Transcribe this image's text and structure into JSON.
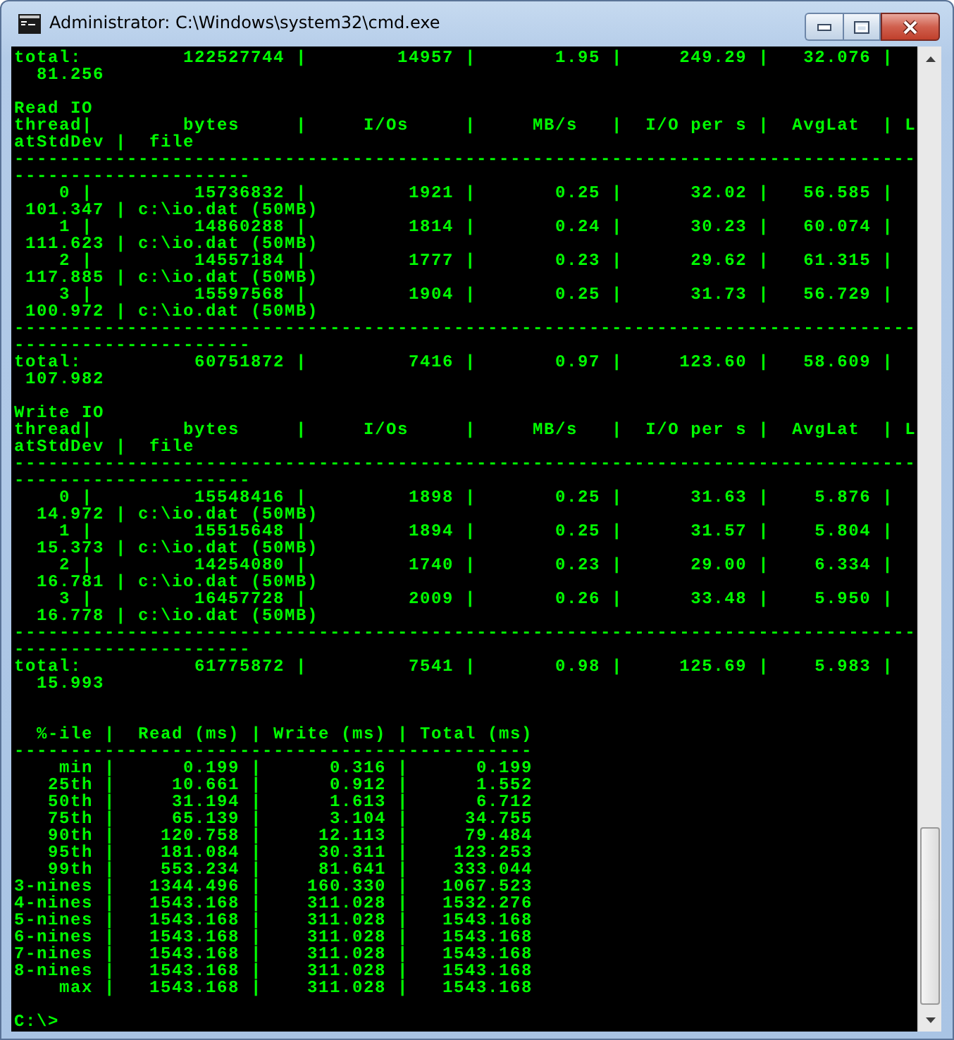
{
  "window": {
    "title": "Administrator: C:\\Windows\\system32\\cmd.exe"
  },
  "console": {
    "lines": [
      {
        "kind": "text",
        "text": "total:         122527744 |        14957 |       1.95 |     249.29 |   32.076 |"
      },
      {
        "kind": "text",
        "text": "  81.256"
      },
      {
        "kind": "blank"
      },
      {
        "kind": "text",
        "text": "Read IO"
      },
      {
        "kind": "text",
        "text": "thread|        bytes     |     I/Os     |     MB/s   |  I/O per s |  AvgLat  | L"
      },
      {
        "kind": "text",
        "text": "atStdDev |  file"
      },
      {
        "kind": "text",
        "text": "--------------------------------------------------------------------------------"
      },
      {
        "kind": "text",
        "text": "---------------------"
      },
      {
        "kind": "text",
        "text": "    0 |         15736832 |         1921 |       0.25 |      32.02 |   56.585 |"
      },
      {
        "kind": "text",
        "text": " 101.347 | c:\\io.dat (50MB)"
      },
      {
        "kind": "text",
        "text": "    1 |         14860288 |         1814 |       0.24 |      30.23 |   60.074 |"
      },
      {
        "kind": "text",
        "text": " 111.623 | c:\\io.dat (50MB)"
      },
      {
        "kind": "text",
        "text": "    2 |         14557184 |         1777 |       0.23 |      29.62 |   61.315 |"
      },
      {
        "kind": "text",
        "text": " 117.885 | c:\\io.dat (50MB)"
      },
      {
        "kind": "text",
        "text": "    3 |         15597568 |         1904 |       0.25 |      31.73 |   56.729 |"
      },
      {
        "kind": "text",
        "text": " 100.972 | c:\\io.dat (50MB)"
      },
      {
        "kind": "text",
        "text": "--------------------------------------------------------------------------------"
      },
      {
        "kind": "text",
        "text": "---------------------"
      },
      {
        "kind": "text",
        "text": "total:          60751872 |         7416 |       0.97 |     123.60 |   58.609 |"
      },
      {
        "kind": "text",
        "text": " 107.982"
      },
      {
        "kind": "blank"
      },
      {
        "kind": "text",
        "text": "Write IO"
      },
      {
        "kind": "text",
        "text": "thread|        bytes     |     I/Os     |     MB/s   |  I/O per s |  AvgLat  | L"
      },
      {
        "kind": "text",
        "text": "atStdDev |  file"
      },
      {
        "kind": "text",
        "text": "--------------------------------------------------------------------------------"
      },
      {
        "kind": "text",
        "text": "---------------------"
      },
      {
        "kind": "text",
        "text": "    0 |         15548416 |         1898 |       0.25 |      31.63 |    5.876 |"
      },
      {
        "kind": "text",
        "text": "  14.972 | c:\\io.dat (50MB)"
      },
      {
        "kind": "text",
        "text": "    1 |         15515648 |         1894 |       0.25 |      31.57 |    5.804 |"
      },
      {
        "kind": "text",
        "text": "  15.373 | c:\\io.dat (50MB)"
      },
      {
        "kind": "text",
        "text": "    2 |         14254080 |         1740 |       0.23 |      29.00 |    6.334 |"
      },
      {
        "kind": "text",
        "text": "  16.781 | c:\\io.dat (50MB)"
      },
      {
        "kind": "text",
        "text": "    3 |         16457728 |         2009 |       0.26 |      33.48 |    5.950 |"
      },
      {
        "kind": "text",
        "text": "  16.778 | c:\\io.dat (50MB)"
      },
      {
        "kind": "text",
        "text": "--------------------------------------------------------------------------------"
      },
      {
        "kind": "text",
        "text": "---------------------"
      },
      {
        "kind": "text",
        "text": "total:          61775872 |         7541 |       0.98 |     125.69 |    5.983 |"
      },
      {
        "kind": "text",
        "text": "  15.993"
      },
      {
        "kind": "blank"
      },
      {
        "kind": "blank"
      },
      {
        "kind": "text",
        "text": "  %-ile |  Read (ms) | Write (ms) | Total (ms)"
      },
      {
        "kind": "text",
        "text": "----------------------------------------------"
      },
      {
        "kind": "text",
        "text": "    min |      0.199 |      0.316 |      0.199"
      },
      {
        "kind": "text",
        "text": "   25th |     10.661 |      0.912 |      1.552"
      },
      {
        "kind": "text",
        "text": "   50th |     31.194 |      1.613 |      6.712"
      },
      {
        "kind": "text",
        "text": "   75th |     65.139 |      3.104 |     34.755"
      },
      {
        "kind": "text",
        "text": "   90th |    120.758 |     12.113 |     79.484"
      },
      {
        "kind": "text",
        "text": "   95th |    181.084 |     30.311 |    123.253"
      },
      {
        "kind": "text",
        "text": "   99th |    553.234 |     81.641 |    333.044"
      },
      {
        "kind": "text",
        "text": "3-nines |   1344.496 |    160.330 |   1067.523"
      },
      {
        "kind": "text",
        "text": "4-nines |   1543.168 |    311.028 |   1532.276"
      },
      {
        "kind": "text",
        "text": "5-nines |   1543.168 |    311.028 |   1543.168"
      },
      {
        "kind": "text",
        "text": "6-nines |   1543.168 |    311.028 |   1543.168"
      },
      {
        "kind": "text",
        "text": "7-nines |   1543.168 |    311.028 |   1543.168"
      },
      {
        "kind": "text",
        "text": "8-nines |   1543.168 |    311.028 |   1543.168"
      },
      {
        "kind": "text",
        "text": "    max |   1543.168 |    311.028 |   1543.168"
      },
      {
        "kind": "blank"
      },
      {
        "kind": "text",
        "text": "C:\\>"
      }
    ]
  }
}
